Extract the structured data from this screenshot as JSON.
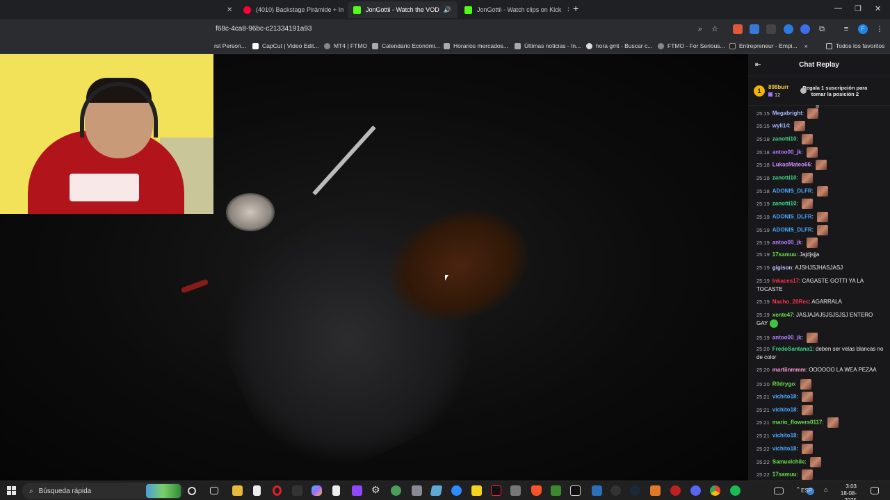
{
  "browser": {
    "tabs": [
      {
        "label": "(4010) Backstage Pirámide + In",
        "color": "#ff0033",
        "active": false
      },
      {
        "label": "JonGottii - Watch the VOD",
        "color": "#53fc18",
        "active": true
      },
      {
        "label": "JonGottii - Watch clips on Kick",
        "color": "#53fc18",
        "active": false
      }
    ],
    "new_tab": "+",
    "url": "f68c-4ca8-96bc-c21334191a93",
    "bookmarks": [
      "rst Person...",
      "CapCut | Video Edit...",
      "MT4 | FTMO",
      "Calendario Económi...",
      "Horarios mercados...",
      "Últimas noticias - In...",
      "hora gmt - Buscar c...",
      "FTMO - For Serious...",
      "Entrepreneur - Empi...",
      "Todos los favoritos"
    ]
  },
  "chat": {
    "title": "Chat Replay",
    "pinned": {
      "rank": "1",
      "user": "898burr",
      "count": "12",
      "cta": "Regala 1 suscripción para tomar la posición 2"
    },
    "messages": [
      {
        "ts": "25:15",
        "user": "Megabright",
        "color": "#a8b8ff",
        "text": "",
        "emote": true
      },
      {
        "ts": "25:15",
        "user": "wyli14",
        "color": "#a8b8ff",
        "text": "",
        "emote": true
      },
      {
        "ts": "25:18",
        "user": "zanotti10",
        "color": "#3fd88a",
        "text": "",
        "emote": true
      },
      {
        "ts": "25:18",
        "user": "antoo00_jk",
        "color": "#b47cff",
        "text": "",
        "emote": true
      },
      {
        "ts": "25:18",
        "user": "LukasMateo66",
        "color": "#d48cff",
        "text": "",
        "emote": true
      },
      {
        "ts": "25:18",
        "user": "zanotti10",
        "color": "#3fd88a",
        "text": "",
        "emote": true
      },
      {
        "ts": "25:18",
        "user": "ADONIS_DLFR",
        "color": "#4aa8ff",
        "text": "",
        "emote": true
      },
      {
        "ts": "25:19",
        "user": "zanotti10",
        "color": "#3fd88a",
        "text": "",
        "emote": true
      },
      {
        "ts": "25:19",
        "user": "ADONIS_DLFR",
        "color": "#4aa8ff",
        "text": "",
        "emote": true
      },
      {
        "ts": "25:19",
        "user": "ADONIS_DLFR",
        "color": "#4aa8ff",
        "text": "",
        "emote": true
      },
      {
        "ts": "25:19",
        "user": "antoo00_jk",
        "color": "#b47cff",
        "text": "",
        "emote": true
      },
      {
        "ts": "25:19",
        "user": "17samuu",
        "color": "#6ae04a",
        "text": "Jajdjsjja",
        "emote": false
      },
      {
        "ts": "25:19",
        "user": "gigison",
        "color": "#c0c8ff",
        "text": "AJSHJSJHASJASJ",
        "emote": false
      },
      {
        "ts": "25:19",
        "user": "Inkaces17",
        "color": "#ff3050",
        "text": "CAGASTE GOTTI YA LA TOCASTE",
        "emote": false
      },
      {
        "ts": "25:19",
        "user": "Nacho_20Rec",
        "color": "#ff3050",
        "text": "AGARRALA",
        "emote": false
      },
      {
        "ts": "25:19",
        "user": "xente47",
        "color": "#6ae04a",
        "text": "JASJAJAJSJSJSJSJ ENTERO GAY",
        "emote": false
      },
      {
        "ts": "25:19",
        "user": "antoo00_jk",
        "color": "#b47cff",
        "text": "",
        "emote": true
      },
      {
        "ts": "25:20",
        "user": "FredoSantana1",
        "color": "#3fd88a",
        "text": "deben ser velas blancas no de color",
        "emote": false
      },
      {
        "ts": "25:20",
        "user": "martiinmmm",
        "color": "#ff9ad5",
        "text": "OOOOOO LA WEA PEZAA",
        "emote": false
      },
      {
        "ts": "25:20",
        "user": "R0drygo",
        "color": "#6ae04a",
        "text": "",
        "emote": true
      },
      {
        "ts": "25:21",
        "user": "vichito18",
        "color": "#4aa8ff",
        "text": "",
        "emote": true
      },
      {
        "ts": "25:21",
        "user": "vichito18",
        "color": "#4aa8ff",
        "text": "",
        "emote": true
      },
      {
        "ts": "25:21",
        "user": "mario_flowers0117",
        "color": "#6ae04a",
        "text": "",
        "emote": true
      },
      {
        "ts": "25:21",
        "user": "vichito18",
        "color": "#4aa8ff",
        "text": "",
        "emote": true
      },
      {
        "ts": "25:22",
        "user": "vichito18",
        "color": "#4aa8ff",
        "text": "",
        "emote": true
      },
      {
        "ts": "25:22",
        "user": "Samuelchile",
        "color": "#6ae04a",
        "text": "",
        "emote": true
      },
      {
        "ts": "25:22",
        "user": "17samuu",
        "color": "#6ae04a",
        "text": "",
        "emote": true
      }
    ]
  },
  "taskbar": {
    "search_placeholder": "Búsqueda rápida",
    "lang": "ESP",
    "time": "3:03",
    "date": "18-08-2025"
  }
}
